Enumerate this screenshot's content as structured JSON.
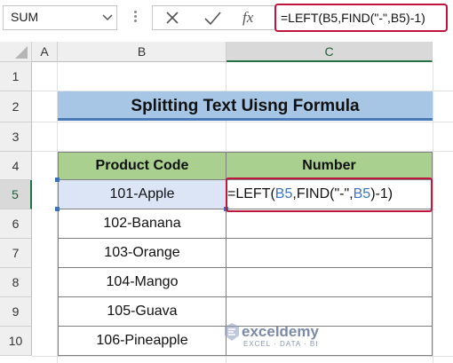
{
  "formula_bar": {
    "name_box": "SUM",
    "cancel_icon": "close-icon",
    "enter_icon": "check-icon",
    "fx_label": "fx",
    "formula_parts": [
      "=LEFT(",
      "B5",
      ",FIND(\"-\",",
      "B5",
      ")-1)"
    ]
  },
  "columns": [
    "A",
    "B",
    "C"
  ],
  "rows": [
    "1",
    "2",
    "3",
    "4",
    "5",
    "6",
    "7",
    "8",
    "9",
    "10"
  ],
  "title": "Splitting Text Uisng Formula",
  "table": {
    "headers": [
      "Product Code",
      "Number"
    ],
    "product_codes": [
      "101-Apple",
      "102-Banana",
      "103-Orange",
      "104-Mango",
      "105-Guava",
      "106-Pineapple"
    ],
    "numbers": [
      "",
      "",
      "",
      "",
      "",
      ""
    ]
  },
  "watermark": {
    "brand": "exceldemy",
    "tagline": "EXCEL · DATA · BI"
  },
  "colors": {
    "header_green": "#a9d08e",
    "title_blue": "#a7c6e6",
    "highlight_red": "#c0143c",
    "reference_blue": "#3b73c4",
    "excel_green": "#217346"
  }
}
